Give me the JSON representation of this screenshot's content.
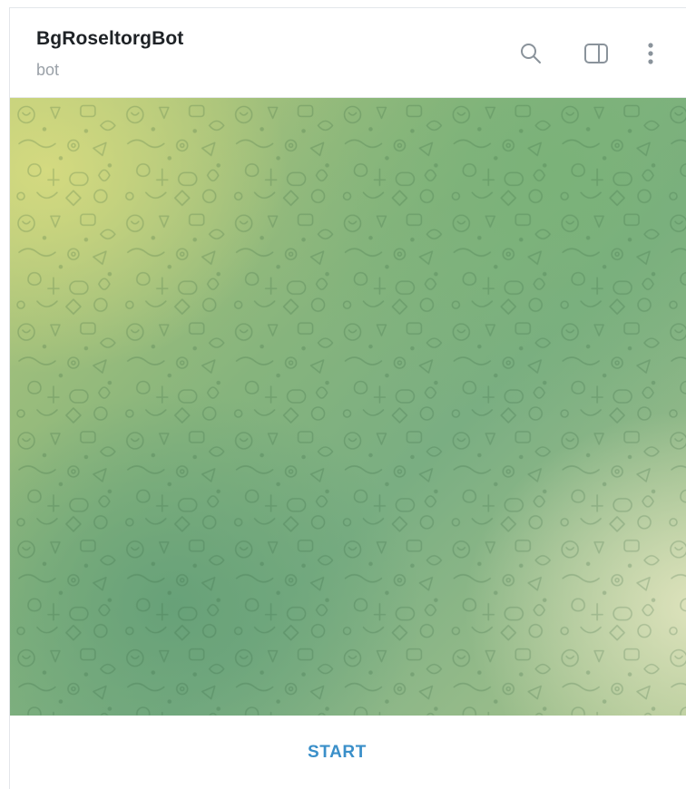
{
  "header": {
    "title": "BgRoseltorgBot",
    "subtitle": "bot",
    "actions": [
      {
        "icon": "search-icon"
      },
      {
        "icon": "sidebar-toggle-icon"
      },
      {
        "icon": "more-vertical-icon"
      }
    ]
  },
  "chat": {
    "wallpaper": "doodle-pattern-green-gradient"
  },
  "footer": {
    "start_label": "START"
  },
  "colors": {
    "accent": "#3a8fc9",
    "title": "#1e2226",
    "subtitle": "#9aa1a8",
    "icon": "#8a939b"
  }
}
